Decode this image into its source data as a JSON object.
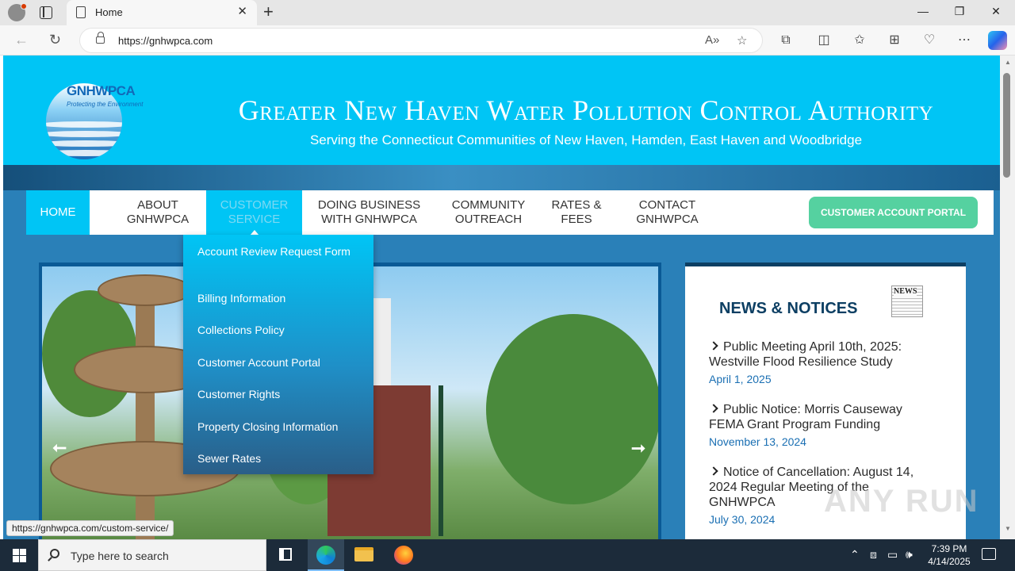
{
  "browser": {
    "tab_title": "Home",
    "tab_close": "✕",
    "new_tab": "+",
    "url": "https://gnhwpca.com",
    "window_controls": [
      "—",
      "❐",
      "✕"
    ]
  },
  "site": {
    "logo_text": "GNHWPCA",
    "logo_tagline": "Protecting the Environment",
    "title": "Greater New Haven Water Pollution Control Authority",
    "subtitle": "Serving the Connecticut Communities of New Haven, Hamden, East Haven and Woodbridge"
  },
  "nav": {
    "items": [
      {
        "label": "HOME",
        "state": "active"
      },
      {
        "label": "ABOUT GNHWPCA",
        "state": "normal"
      },
      {
        "label": "CUSTOMER SERVICE",
        "state": "hover"
      },
      {
        "label": "DOING BUSINESS WITH GNHWPCA",
        "state": "normal"
      },
      {
        "label": "COMMUNITY OUTREACH",
        "state": "normal"
      },
      {
        "label": "RATES & FEES",
        "state": "normal"
      },
      {
        "label": "CONTACT GNHWPCA",
        "state": "normal"
      }
    ],
    "portal_button": "CUSTOMER ACCOUNT PORTAL"
  },
  "dropdown": {
    "items": [
      "Account Review Request Form",
      "Billing Information",
      "Collections Policy",
      "Customer Account Portal",
      "Customer Rights",
      "Property Closing Information",
      "Sewer Rates"
    ]
  },
  "slider": {
    "prev": "⭠",
    "next": "⭢"
  },
  "news": {
    "title": "NEWS & NOTICES",
    "icon_label": "NEWS",
    "items": [
      {
        "headline": "Public Meeting April 10th, 2025: Westville Flood Resilience Study",
        "date": "April 1, 2025"
      },
      {
        "headline": "Public Notice: Morris Causeway FEMA Grant Program Funding",
        "date": "November 13, 2024"
      },
      {
        "headline": "Notice of Cancellation: August 14, 2024 Regular Meeting of the GNHWPCA",
        "date": "July 30, 2024"
      }
    ]
  },
  "status_url": "https://gnhwpca.com/custom-service/",
  "watermark": "ANY RUN",
  "taskbar": {
    "search_placeholder": "Type here to search",
    "time": "7:39 PM",
    "date": "4/14/2025"
  },
  "colors": {
    "header_cyan": "#00c5f5",
    "portal_green": "#55d1a0",
    "news_navy": "#0d3f63",
    "date_blue": "#1a6fb3"
  }
}
